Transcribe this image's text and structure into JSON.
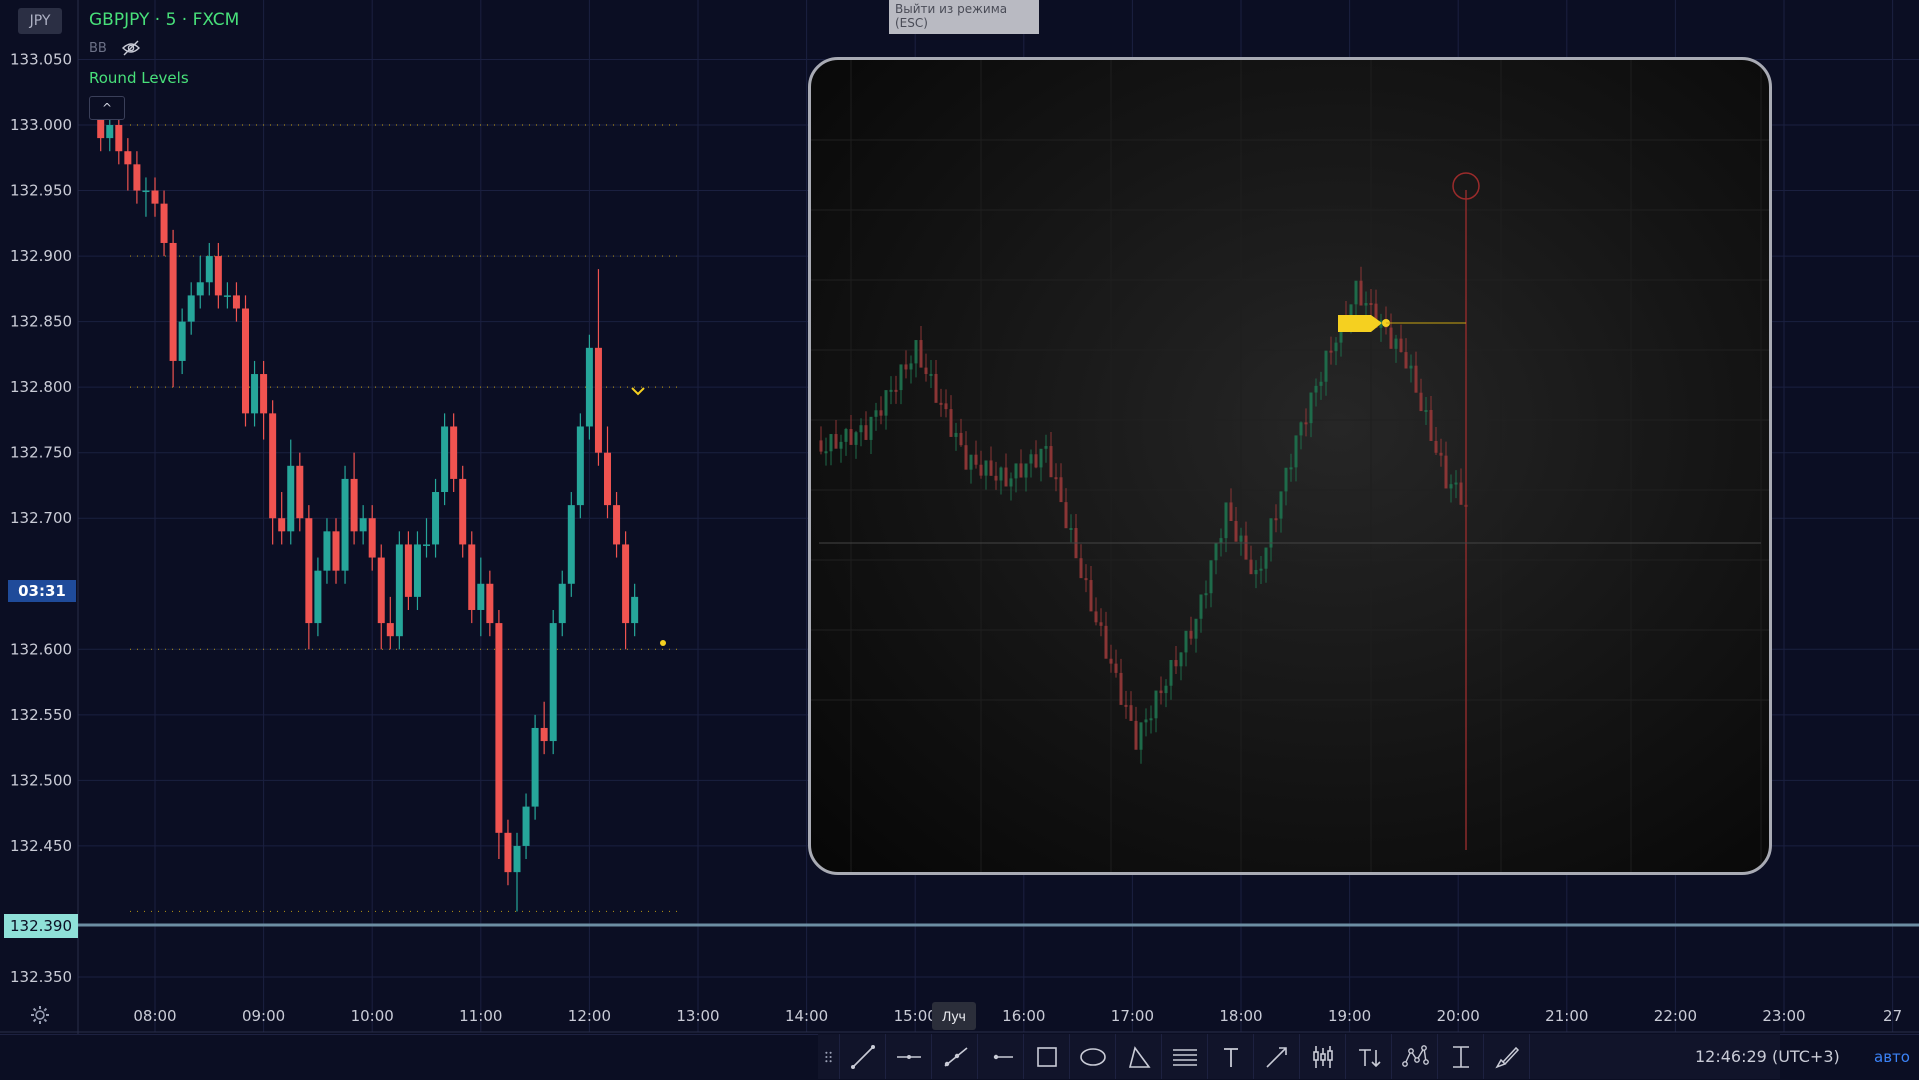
{
  "header": {
    "currency_badge": "JPY",
    "symbol": "GBPJPY · 5 · FXCM",
    "indicator_bb": "BB",
    "indicator_round_levels": "Round Levels",
    "collapse_glyph": "^"
  },
  "exit_tooltip": "Выйти из режима (ESC)",
  "countdown": "03:31",
  "current_price": "132.390",
  "price_axis_labels": [
    "133.050",
    "133.000",
    "132.950",
    "132.900",
    "132.850",
    "132.800",
    "132.750",
    "132.700",
    "132.600",
    "132.550",
    "132.500",
    "132.450",
    "132.350"
  ],
  "time_axis_labels": [
    "08:00",
    "09:00",
    "10:00",
    "11:00",
    "12:00",
    "13:00",
    "14:00",
    "15:00",
    "16:00",
    "17:00",
    "18:00",
    "19:00",
    "20:00",
    "21:00",
    "22:00",
    "23:00",
    "27"
  ],
  "toolbar": {
    "tooltip": "Луч",
    "tools": [
      "grip-icon",
      "trend-line-icon",
      "horizontal-line-icon",
      "ray-icon",
      "horizontal-ray-icon",
      "rectangle-icon",
      "ellipse-icon",
      "triangle-icon",
      "parallel-channel-icon",
      "text-icon",
      "arrow-line-icon",
      "long-position-icon",
      "text-anchor-icon",
      "pattern-icon",
      "price-range-icon",
      "brush-icon"
    ]
  },
  "status": {
    "clock": "12:46:29 (UTC+3)",
    "scale_mode": "авто"
  },
  "colors": {
    "background": "#0b0e23",
    "up_candle": "#26a69a",
    "down_candle": "#ef5350",
    "accent_green": "#48e07a",
    "marker_yellow": "#f5d020"
  },
  "chart_data": {
    "type": "candlestick",
    "symbol": "GBPJPY",
    "timeframe": "5",
    "ylim": [
      132.33,
      133.07
    ],
    "candles": [
      {
        "t": "07:30",
        "o": 133.01,
        "h": 133.02,
        "l": 132.98,
        "c": 132.99
      },
      {
        "t": "07:35",
        "o": 132.99,
        "h": 133.01,
        "l": 132.98,
        "c": 133.0
      },
      {
        "t": "07:40",
        "o": 133.0,
        "h": 133.01,
        "l": 132.97,
        "c": 132.98
      },
      {
        "t": "07:45",
        "o": 132.98,
        "h": 132.99,
        "l": 132.95,
        "c": 132.97
      },
      {
        "t": "07:50",
        "o": 132.97,
        "h": 132.98,
        "l": 132.94,
        "c": 132.95
      },
      {
        "t": "07:55",
        "o": 132.95,
        "h": 132.96,
        "l": 132.93,
        "c": 132.95
      },
      {
        "t": "08:00",
        "o": 132.95,
        "h": 132.96,
        "l": 132.93,
        "c": 132.94
      },
      {
        "t": "08:05",
        "o": 132.94,
        "h": 132.95,
        "l": 132.9,
        "c": 132.91
      },
      {
        "t": "08:10",
        "o": 132.91,
        "h": 132.92,
        "l": 132.8,
        "c": 132.82
      },
      {
        "t": "08:15",
        "o": 132.82,
        "h": 132.86,
        "l": 132.81,
        "c": 132.85
      },
      {
        "t": "08:20",
        "o": 132.85,
        "h": 132.88,
        "l": 132.84,
        "c": 132.87
      },
      {
        "t": "08:25",
        "o": 132.87,
        "h": 132.9,
        "l": 132.86,
        "c": 132.88
      },
      {
        "t": "08:30",
        "o": 132.88,
        "h": 132.91,
        "l": 132.87,
        "c": 132.9
      },
      {
        "t": "08:35",
        "o": 132.9,
        "h": 132.91,
        "l": 132.86,
        "c": 132.87
      },
      {
        "t": "08:40",
        "o": 132.87,
        "h": 132.88,
        "l": 132.86,
        "c": 132.87
      },
      {
        "t": "08:45",
        "o": 132.87,
        "h": 132.88,
        "l": 132.85,
        "c": 132.86
      },
      {
        "t": "08:50",
        "o": 132.86,
        "h": 132.87,
        "l": 132.77,
        "c": 132.78
      },
      {
        "t": "08:55",
        "o": 132.78,
        "h": 132.82,
        "l": 132.77,
        "c": 132.81
      },
      {
        "t": "09:00",
        "o": 132.81,
        "h": 132.82,
        "l": 132.76,
        "c": 132.78
      },
      {
        "t": "09:05",
        "o": 132.78,
        "h": 132.79,
        "l": 132.68,
        "c": 132.7
      },
      {
        "t": "09:10",
        "o": 132.7,
        "h": 132.72,
        "l": 132.68,
        "c": 132.69
      },
      {
        "t": "09:15",
        "o": 132.69,
        "h": 132.76,
        "l": 132.68,
        "c": 132.74
      },
      {
        "t": "09:20",
        "o": 132.74,
        "h": 132.75,
        "l": 132.69,
        "c": 132.7
      },
      {
        "t": "09:25",
        "o": 132.7,
        "h": 132.71,
        "l": 132.6,
        "c": 132.62
      },
      {
        "t": "09:30",
        "o": 132.62,
        "h": 132.67,
        "l": 132.61,
        "c": 132.66
      },
      {
        "t": "09:35",
        "o": 132.66,
        "h": 132.7,
        "l": 132.65,
        "c": 132.69
      },
      {
        "t": "09:40",
        "o": 132.69,
        "h": 132.7,
        "l": 132.65,
        "c": 132.66
      },
      {
        "t": "09:45",
        "o": 132.66,
        "h": 132.74,
        "l": 132.65,
        "c": 132.73
      },
      {
        "t": "09:50",
        "o": 132.73,
        "h": 132.75,
        "l": 132.68,
        "c": 132.69
      },
      {
        "t": "09:55",
        "o": 132.69,
        "h": 132.71,
        "l": 132.68,
        "c": 132.7
      },
      {
        "t": "10:00",
        "o": 132.7,
        "h": 132.71,
        "l": 132.66,
        "c": 132.67
      },
      {
        "t": "10:05",
        "o": 132.67,
        "h": 132.68,
        "l": 132.6,
        "c": 132.62
      },
      {
        "t": "10:10",
        "o": 132.62,
        "h": 132.64,
        "l": 132.6,
        "c": 132.61
      },
      {
        "t": "10:15",
        "o": 132.61,
        "h": 132.69,
        "l": 132.6,
        "c": 132.68
      },
      {
        "t": "10:20",
        "o": 132.68,
        "h": 132.69,
        "l": 132.63,
        "c": 132.64
      },
      {
        "t": "10:25",
        "o": 132.64,
        "h": 132.69,
        "l": 132.63,
        "c": 132.68
      },
      {
        "t": "10:30",
        "o": 132.68,
        "h": 132.7,
        "l": 132.67,
        "c": 132.68
      },
      {
        "t": "10:35",
        "o": 132.68,
        "h": 132.73,
        "l": 132.67,
        "c": 132.72
      },
      {
        "t": "10:40",
        "o": 132.72,
        "h": 132.78,
        "l": 132.71,
        "c": 132.77
      },
      {
        "t": "10:45",
        "o": 132.77,
        "h": 132.78,
        "l": 132.72,
        "c": 132.73
      },
      {
        "t": "10:50",
        "o": 132.73,
        "h": 132.74,
        "l": 132.67,
        "c": 132.68
      },
      {
        "t": "10:55",
        "o": 132.68,
        "h": 132.69,
        "l": 132.62,
        "c": 132.63
      },
      {
        "t": "11:00",
        "o": 132.63,
        "h": 132.67,
        "l": 132.61,
        "c": 132.65
      },
      {
        "t": "11:05",
        "o": 132.65,
        "h": 132.66,
        "l": 132.61,
        "c": 132.62
      },
      {
        "t": "11:10",
        "o": 132.62,
        "h": 132.63,
        "l": 132.44,
        "c": 132.46
      },
      {
        "t": "11:15",
        "o": 132.46,
        "h": 132.47,
        "l": 132.42,
        "c": 132.43
      },
      {
        "t": "11:20",
        "o": 132.43,
        "h": 132.46,
        "l": 132.4,
        "c": 132.45
      },
      {
        "t": "11:25",
        "o": 132.45,
        "h": 132.49,
        "l": 132.44,
        "c": 132.48
      },
      {
        "t": "11:30",
        "o": 132.48,
        "h": 132.55,
        "l": 132.47,
        "c": 132.54
      },
      {
        "t": "11:35",
        "o": 132.54,
        "h": 132.56,
        "l": 132.52,
        "c": 132.53
      },
      {
        "t": "11:40",
        "o": 132.53,
        "h": 132.63,
        "l": 132.52,
        "c": 132.62
      },
      {
        "t": "11:45",
        "o": 132.62,
        "h": 132.66,
        "l": 132.61,
        "c": 132.65
      },
      {
        "t": "11:50",
        "o": 132.65,
        "h": 132.72,
        "l": 132.64,
        "c": 132.71
      },
      {
        "t": "11:55",
        "o": 132.71,
        "h": 132.78,
        "l": 132.7,
        "c": 132.77
      },
      {
        "t": "12:00",
        "o": 132.77,
        "h": 132.84,
        "l": 132.76,
        "c": 132.83
      },
      {
        "t": "12:05",
        "o": 132.83,
        "h": 132.89,
        "l": 132.74,
        "c": 132.75
      },
      {
        "t": "12:10",
        "o": 132.75,
        "h": 132.77,
        "l": 132.7,
        "c": 132.71
      },
      {
        "t": "12:15",
        "o": 132.71,
        "h": 132.72,
        "l": 132.67,
        "c": 132.68
      },
      {
        "t": "12:20",
        "o": 132.68,
        "h": 132.69,
        "l": 132.6,
        "c": 132.62
      },
      {
        "t": "12:25",
        "o": 132.62,
        "h": 132.65,
        "l": 132.61,
        "c": 132.64
      }
    ]
  }
}
